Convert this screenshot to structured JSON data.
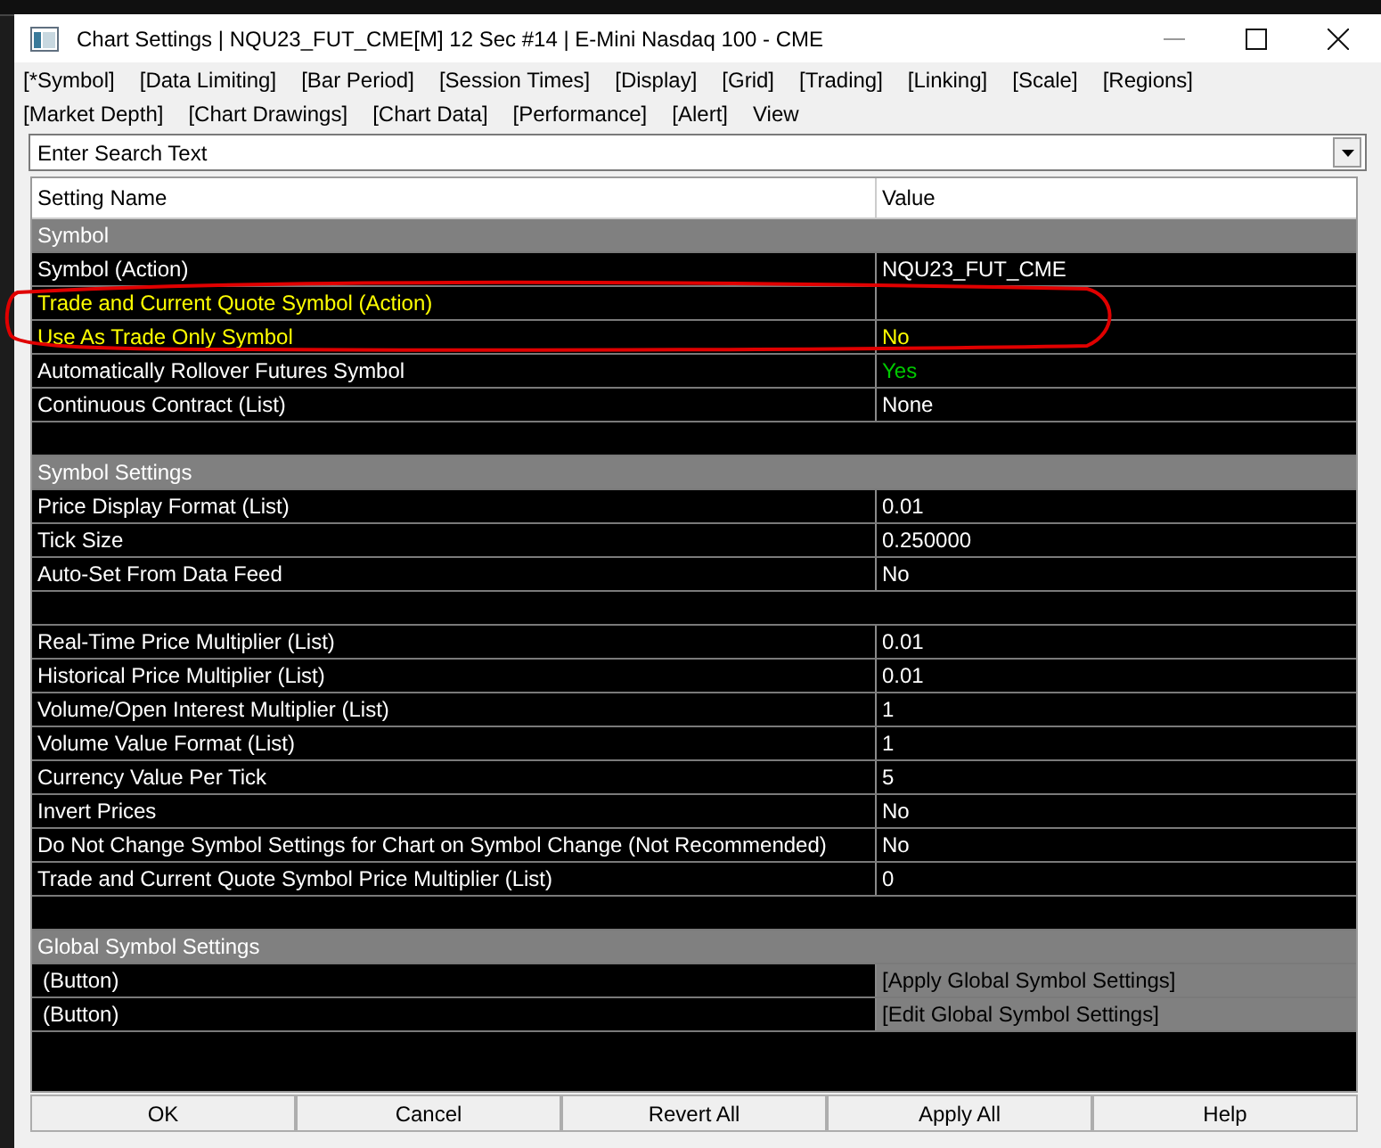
{
  "window": {
    "title": "Chart Settings | NQU23_FUT_CME[M]  12 Sec  #14 | E-Mini Nasdaq 100 - CME"
  },
  "tabs": [
    {
      "label": "[*Symbol]"
    },
    {
      "label": "[Data Limiting]"
    },
    {
      "label": "[Bar Period]"
    },
    {
      "label": "[Session Times]"
    },
    {
      "label": "[Display]"
    },
    {
      "label": "[Grid]"
    },
    {
      "label": "[Trading]"
    },
    {
      "label": "[Linking]"
    },
    {
      "label": "[Scale]"
    },
    {
      "label": "[Regions]"
    },
    {
      "label": "[Market Depth]"
    },
    {
      "label": "[Chart Drawings]"
    },
    {
      "label": "[Chart Data]"
    },
    {
      "label": "[Performance]"
    },
    {
      "label": "[Alert]"
    },
    {
      "label": "View"
    }
  ],
  "search": {
    "placeholder": "Enter Search Text"
  },
  "table": {
    "columns": [
      "Setting Name",
      "Value"
    ],
    "rows": [
      {
        "kind": "group",
        "name": "Symbol"
      },
      {
        "kind": "setting",
        "name": "Symbol (Action)",
        "value": "NQU23_FUT_CME",
        "highlighted": false,
        "value_active": false
      },
      {
        "kind": "setting",
        "name": "Trade and Current Quote Symbol (Action)",
        "highlighted": true
      },
      {
        "kind": "setting",
        "name": "Use As Trade Only Symbol",
        "value": "No",
        "highlighted": true,
        "value_active": false
      },
      {
        "kind": "setting",
        "name": "Automatically Rollover Futures Symbol",
        "value": "Yes",
        "highlighted": false,
        "value_active": true
      },
      {
        "kind": "setting",
        "name": "Continuous Contract (List)",
        "value": "None",
        "highlighted": false,
        "value_active": false
      },
      {
        "kind": "blank"
      },
      {
        "kind": "group",
        "name": "Symbol Settings"
      },
      {
        "kind": "setting",
        "name": "Price Display Format (List)",
        "value": "0.01",
        "highlighted": false,
        "value_active": false
      },
      {
        "kind": "setting",
        "name": "Tick Size",
        "value": "0.250000",
        "highlighted": false,
        "value_active": false
      },
      {
        "kind": "setting",
        "name": "Auto-Set From Data Feed",
        "value": "No",
        "highlighted": false,
        "value_active": false
      },
      {
        "kind": "blank"
      },
      {
        "kind": "setting",
        "name": "Real-Time Price Multiplier (List)",
        "value": "0.01",
        "highlighted": false,
        "value_active": false
      },
      {
        "kind": "setting",
        "name": "Historical Price Multiplier (List)",
        "value": "0.01",
        "highlighted": false,
        "value_active": false
      },
      {
        "kind": "setting",
        "name": "Volume/Open Interest Multiplier (List)",
        "value": "1",
        "highlighted": false,
        "value_active": false
      },
      {
        "kind": "setting",
        "name": "Volume Value Format (List)",
        "value": "1",
        "highlighted": false,
        "value_active": false
      },
      {
        "kind": "setting",
        "name": "Currency Value Per Tick",
        "value": "5",
        "highlighted": false,
        "value_active": false
      },
      {
        "kind": "setting",
        "name": "Invert Prices",
        "value": "No",
        "highlighted": false,
        "value_active": false
      },
      {
        "kind": "setting",
        "name": "Do Not Change Symbol Settings for Chart on Symbol Change (Not Recommended)",
        "value": "No",
        "highlighted": false,
        "value_active": false
      },
      {
        "kind": "setting",
        "name": "Trade and Current Quote Symbol Price Multiplier (List)",
        "value": "0",
        "highlighted": false,
        "value_active": false
      },
      {
        "kind": "blank"
      },
      {
        "kind": "group",
        "name": "Global Symbol Settings"
      },
      {
        "kind": "button",
        "name": "(Button)",
        "value": "[Apply Global Symbol Settings]"
      },
      {
        "kind": "button",
        "name": "(Button)",
        "value": "[Edit Global Symbol Settings]"
      }
    ]
  },
  "buttons": [
    "OK",
    "Cancel",
    "Revert All",
    "Apply All",
    "Help"
  ]
}
